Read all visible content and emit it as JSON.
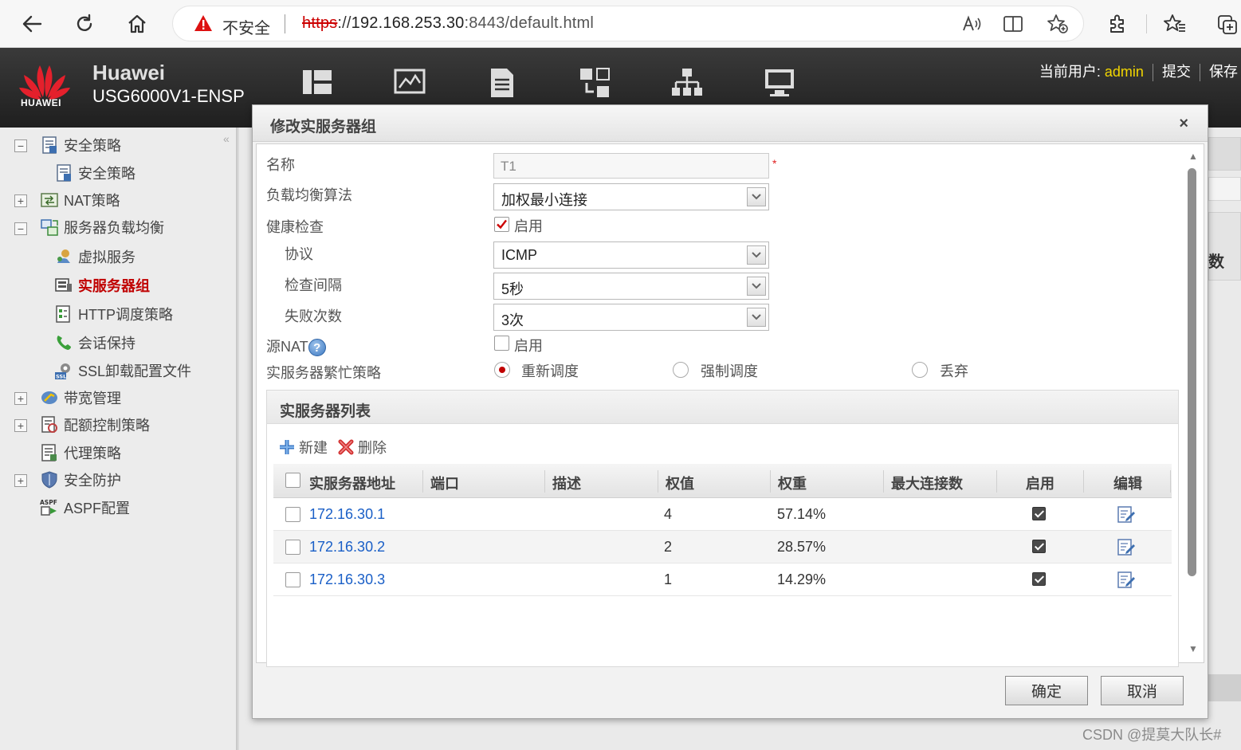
{
  "browser": {
    "insecure_label": "不安全",
    "url_scheme": "https",
    "url_sep": "://",
    "url_host": "192.168.253.30",
    "url_path": ":8443/default.html"
  },
  "header": {
    "brand": "Huawei",
    "model": "USG6000V1-ENSP",
    "logo_text": "HUAWEI",
    "current_user_label": "当前用户:",
    "username": "admin",
    "submit_label": "提交",
    "save_label": "保存"
  },
  "sidebar": {
    "items": [
      {
        "label": "安全策略"
      },
      {
        "label": "安全策略"
      },
      {
        "label": "NAT策略"
      },
      {
        "label": "服务器负载均衡"
      },
      {
        "label": "虚拟服务"
      },
      {
        "label": "实服务器组"
      },
      {
        "label": "HTTP调度策略"
      },
      {
        "label": "会话保持"
      },
      {
        "label": "SSL卸载配置文件"
      },
      {
        "label": "带宽管理"
      },
      {
        "label": "配额控制策略"
      },
      {
        "label": "代理策略"
      },
      {
        "label": "安全防护"
      },
      {
        "label": "ASPF配置"
      }
    ]
  },
  "background": {
    "column_fragment": "数"
  },
  "dialog": {
    "title": "修改实服务器组",
    "close_glyph": "×",
    "fields": {
      "name_label": "名称",
      "name_value": "T1",
      "required_mark": "*",
      "algorithm_label": "负载均衡算法",
      "algorithm_value": "加权最小连接",
      "health_label": "健康检查",
      "health_enable_label": "启用",
      "protocol_label": "协议",
      "protocol_value": "ICMP",
      "interval_label": "检查间隔",
      "interval_value": "5秒",
      "failures_label": "失败次数",
      "failures_value": "3次",
      "snat_label": "源NAT",
      "snat_enable_label": "启用",
      "busy_label": "实服务器繁忙策略",
      "busy_options": [
        "重新调度",
        "强制调度",
        "丢弃"
      ]
    },
    "list": {
      "title": "实服务器列表",
      "new_label": "新建",
      "delete_label": "删除",
      "columns": [
        "实服务器地址",
        "端口",
        "描述",
        "权值",
        "权重",
        "最大连接数",
        "启用",
        "编辑"
      ],
      "rows": [
        {
          "address": "172.16.30.1",
          "port": "",
          "desc": "",
          "weight": "4",
          "ratio": "57.14%",
          "maxconn": "",
          "enabled": true
        },
        {
          "address": "172.16.30.2",
          "port": "",
          "desc": "",
          "weight": "2",
          "ratio": "28.57%",
          "maxconn": "",
          "enabled": true
        },
        {
          "address": "172.16.30.3",
          "port": "",
          "desc": "",
          "weight": "1",
          "ratio": "14.29%",
          "maxconn": "",
          "enabled": true
        }
      ]
    },
    "ok_label": "确定",
    "cancel_label": "取消"
  },
  "watermark": "CSDN @提莫大队长#"
}
